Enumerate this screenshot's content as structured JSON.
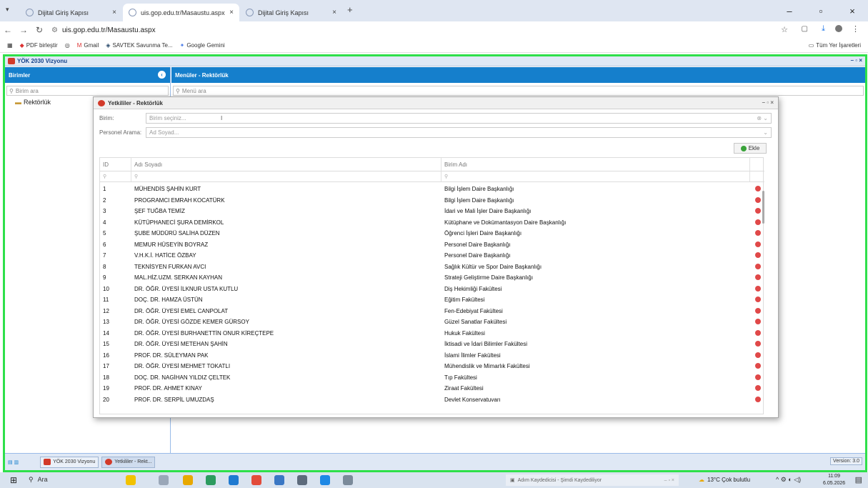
{
  "browser": {
    "tabs": [
      {
        "label": "Dijital Giriş Kapısı",
        "active": false
      },
      {
        "label": "uis.gop.edu.tr/Masaustu.aspx",
        "active": true
      },
      {
        "label": "Dijital Giriş Kapısı",
        "active": false
      }
    ],
    "new_tab": "+",
    "url": "uis.gop.edu.tr/Masaustu.aspx",
    "bookmarks": [
      "PDF birleştir",
      "Gmail",
      "SAVTEK Savunma Te...",
      "Google Gemini"
    ],
    "all_bookmarks": "Tüm Yer İşaretleri"
  },
  "app": {
    "window_title": "YÖK 2030 Vizyonu",
    "left_header": "Birimler",
    "left_search_placeholder": "Birim ara",
    "tree_item": "Rektörlük",
    "right_header": "Menüler - Rektörlük",
    "right_search_placeholder": "Menü ara",
    "version": "Version: 3.0",
    "taskbar_items": [
      "YÖK 2030 Vizyonu",
      "Yetkililer - Rekt..."
    ]
  },
  "dialog": {
    "title": "Yetkililer - Rektörlük",
    "birim_label": "Birim:",
    "birim_placeholder": "Birim seçiniz...",
    "personel_label": "Personel Arama:",
    "personel_placeholder": "Ad Soyad...",
    "add_button": "Ekle",
    "columns": {
      "id": "ID",
      "name": "Adı Soyadı",
      "unit": "Birim Adı"
    },
    "rows": [
      {
        "id": "1",
        "name": "MÜHENDİS ŞAHİN KURT",
        "unit": "Bilgi İşlem Daire Başkanlığı"
      },
      {
        "id": "2",
        "name": "PROGRAMCI EMRAH KOCATÜRK",
        "unit": "Bilgi İşlem Daire Başkanlığı"
      },
      {
        "id": "3",
        "name": "ŞEF TUĞBA TEMİZ",
        "unit": "İdari ve Mali İşler Daire Başkanlığı"
      },
      {
        "id": "4",
        "name": "KÜTÜPHANECİ ŞURA DEMİRKOL",
        "unit": "Kütüphane ve Dokümantasyon Daire Başkanlığı"
      },
      {
        "id": "5",
        "name": "ŞUBE MÜDÜRÜ SALİHA DÜZEN",
        "unit": "Öğrenci İşleri Daire Başkanlığı"
      },
      {
        "id": "6",
        "name": "MEMUR HÜSEYİN BOYRAZ",
        "unit": "Personel Daire Başkanlığı"
      },
      {
        "id": "7",
        "name": "V.H.K.İ. HATİCE ÖZBAY",
        "unit": "Personel Daire Başkanlığı"
      },
      {
        "id": "8",
        "name": "TEKNİSYEN FURKAN AVCI",
        "unit": "Sağlık Kültür ve Spor Daire Başkanlığı"
      },
      {
        "id": "9",
        "name": "MAL.HİZ.UZM. SERKAN KAYHAN",
        "unit": "Strateji Geliştirme Daire Başkanlığı"
      },
      {
        "id": "10",
        "name": "DR. ÖĞR. ÜYESİ İLKNUR USTA KUTLU",
        "unit": "Diş Hekimliği Fakültesi"
      },
      {
        "id": "11",
        "name": "DOÇ. DR. HAMZA ÜSTÜN",
        "unit": "Eğitim Fakültesi"
      },
      {
        "id": "12",
        "name": "DR. ÖĞR. ÜYESİ EMEL CANPOLAT",
        "unit": "Fen-Edebiyat Fakültesi"
      },
      {
        "id": "13",
        "name": "DR. ÖĞR. ÜYESİ GÖZDE KEMER GÜRSOY",
        "unit": "Güzel Sanatlar Fakültesi"
      },
      {
        "id": "14",
        "name": "DR. ÖĞR. ÜYESİ BURHANETTİN ONUR KİREÇTEPE",
        "unit": "Hukuk Fakültesi"
      },
      {
        "id": "15",
        "name": "DR. ÖĞR. ÜYESİ METEHAN ŞAHİN",
        "unit": "İktisadi ve İdari Bilimler Fakültesi"
      },
      {
        "id": "16",
        "name": "PROF. DR. SÜLEYMAN PAK",
        "unit": "İslami İlimler Fakültesi"
      },
      {
        "id": "17",
        "name": "DR. ÖĞR. ÜYESİ MEHMET TOKATLI",
        "unit": "Mühendislik ve Mimarlık Fakültesi"
      },
      {
        "id": "18",
        "name": "DOÇ. DR. NAGİHAN YILDIZ ÇELTEK",
        "unit": "Tıp Fakültesi"
      },
      {
        "id": "19",
        "name": "PROF. DR. AHMET KINAY",
        "unit": "Ziraat Fakültesi"
      },
      {
        "id": "20",
        "name": "PROF. DR. SERPİL UMUZDAŞ",
        "unit": "Devlet Konservatuvarı"
      }
    ]
  },
  "windows_taskbar": {
    "search": "Ara",
    "recorder": "Adım Kaydedicisi - Şimdi Kaydediliyor",
    "weather": "13°C Çok bulutlu",
    "time": "11:09",
    "date": "6.05.2026"
  },
  "colors": {
    "accent": "#157fcc",
    "frame_highlight": "#2ee04a",
    "delete": "#e04848"
  }
}
